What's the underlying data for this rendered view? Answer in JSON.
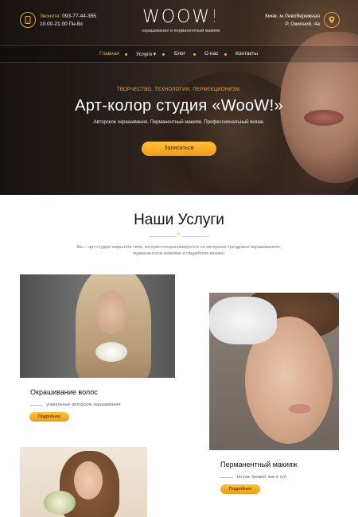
{
  "header": {
    "phone_label": "Звоните:",
    "phone": "093-77-44-355",
    "hours": "10.00-21.00 Пн-Вс",
    "logo_text": "WOOW",
    "logo_mark": "!",
    "tagline": "окрашивание и перманентный макияж",
    "address_line1": "Киев, м.Левобережная",
    "address_line2": "Р. Окипной, 4а"
  },
  "nav": {
    "items": [
      {
        "label": "Главная",
        "active": true
      },
      {
        "label": "Услуги ▾",
        "active": false
      },
      {
        "label": "Блог",
        "active": false
      },
      {
        "label": "О нас",
        "active": false
      },
      {
        "label": "Контакты",
        "active": false
      }
    ]
  },
  "hero": {
    "kicker": "ТВОРЧЕСТВО. ТЕХНОЛОГИИ. ПЕРФЕКЦИОНИЗМ.",
    "title": "Арт-колор студия «WooW!»",
    "subtitle": "Авторское окрашивание. Перманентный макияж. Профессиональный визаж.",
    "cta": "Записаться"
  },
  "services": {
    "title": "Наши Услуги",
    "description": "Мы – арт-студия закрытого типа, которая специализируется на авторских трендовых окрашиваниях, перманентном макияже и свадебном визаже.",
    "cards": [
      {
        "title": "Окрашивание волос",
        "description": "уникальные авторские окрашивания.",
        "button": "Подробнее"
      },
      {
        "title": "Перманентный макияж",
        "description": "татуаж бровей, век и губ.",
        "button": "Подробнее"
      }
    ]
  },
  "colors": {
    "accent": "#f3b12b",
    "hero_bg": "#3a2e27"
  },
  "icons": {
    "phone": "phone-icon",
    "location": "location-pin-icon"
  }
}
